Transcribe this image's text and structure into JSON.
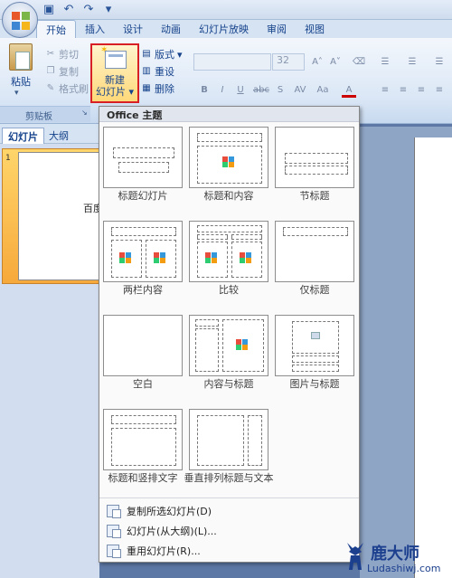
{
  "quick_access": {
    "save": "save-icon",
    "undo": "undo-icon",
    "redo": "redo-icon",
    "customize": "▾"
  },
  "tabs": [
    "开始",
    "插入",
    "设计",
    "动画",
    "幻灯片放映",
    "审阅",
    "视图"
  ],
  "clipboard": {
    "paste": "粘贴",
    "cut": "剪切",
    "copy": "复制",
    "format_painter": "格式刷",
    "group_label": "剪贴板"
  },
  "slides": {
    "new_slide": "新建",
    "new_slide_line2": "幻灯片",
    "layout": "版式",
    "reset": "重设",
    "delete": "删除"
  },
  "font": {
    "size": "32",
    "buttons": [
      "B",
      "I",
      "U",
      "abc",
      "S",
      "AV",
      "Aa",
      "A"
    ]
  },
  "pane": {
    "tab_slides": "幻灯片",
    "tab_outline": "大纲",
    "slide_number": "1",
    "slide_text": "百度"
  },
  "dropdown": {
    "header": "Office 主题",
    "layouts": [
      "标题幻灯片",
      "标题和内容",
      "节标题",
      "两栏内容",
      "比较",
      "仅标题",
      "空白",
      "内容与标题",
      "图片与标题",
      "标题和竖排文字",
      "垂直排列标题与文本"
    ],
    "menu": [
      "复制所选幻灯片(D)",
      "幻灯片(从大纲)(L)...",
      "重用幻灯片(R)..."
    ]
  },
  "watermark": {
    "cn": "鹿大师",
    "en": "Ludashiwj.com"
  },
  "colors": {
    "highlight_border": "#d81f26",
    "ribbon_text": "#15428b",
    "selected_thumb": "#f7a93b"
  }
}
